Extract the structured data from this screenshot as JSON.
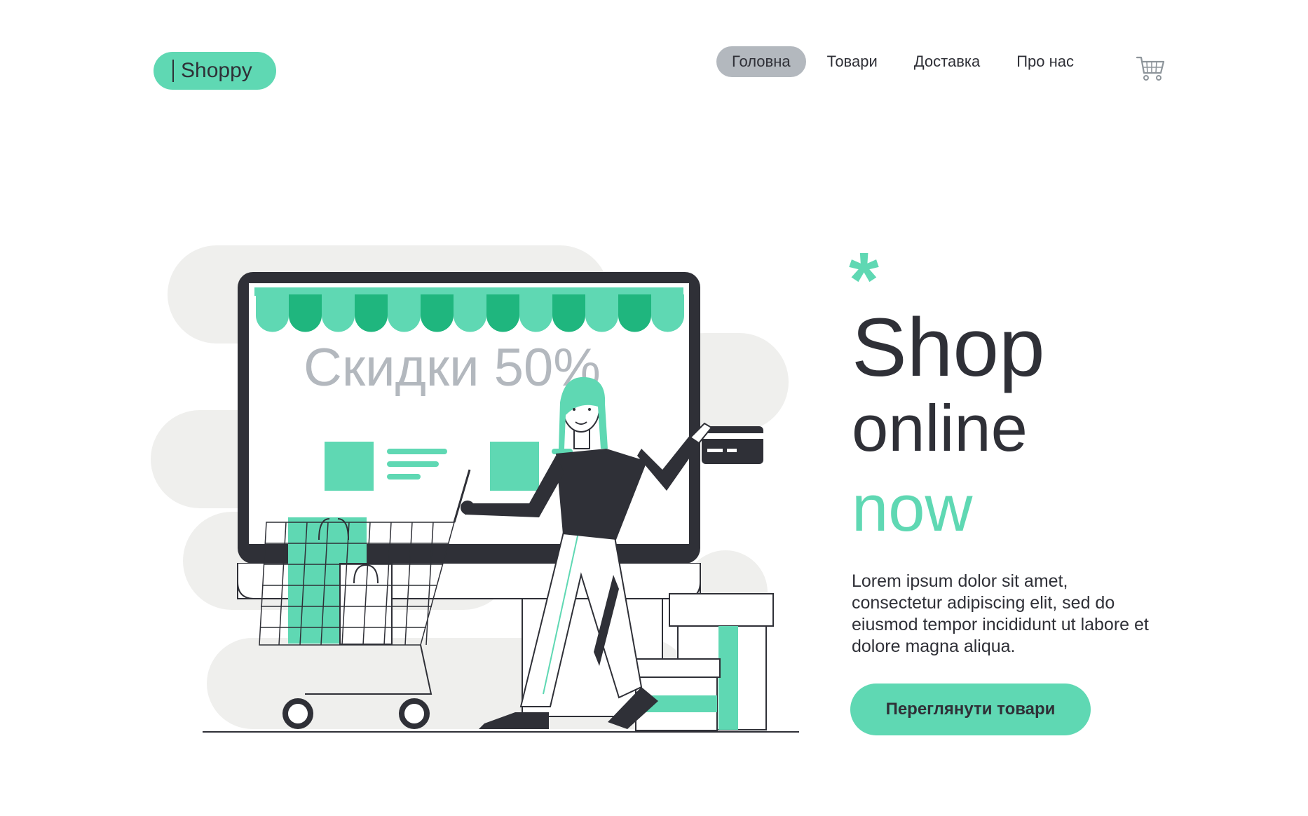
{
  "brand": {
    "logo_text": "Shoppy"
  },
  "nav": {
    "items": [
      {
        "label": "Головна",
        "active": true
      },
      {
        "label": "Товари",
        "active": false
      },
      {
        "label": "Доставка",
        "active": false
      },
      {
        "label": "Про нас",
        "active": false
      }
    ],
    "cart_icon": "shopping-cart-icon"
  },
  "illustration": {
    "sale_text": "Скидки 50%",
    "description": "woman with shopping cart in front of online store monitor"
  },
  "hero": {
    "asterisk": "*",
    "line1": "Shop",
    "line2": "online",
    "line3": "now",
    "description": "Lorem ipsum dolor sit amet, consectetur adipiscing elit, sed do eiusmod tempor incididunt ut labore et dolore magna aliqua.",
    "cta_label": "Переглянути товари"
  },
  "colors": {
    "accent": "#5fd8b3",
    "accent_dark": "#1fb67e",
    "text": "#2f3037",
    "nav_active": "#b3b8be",
    "blob": "#efefed",
    "sale_text": "#b3b8be"
  }
}
